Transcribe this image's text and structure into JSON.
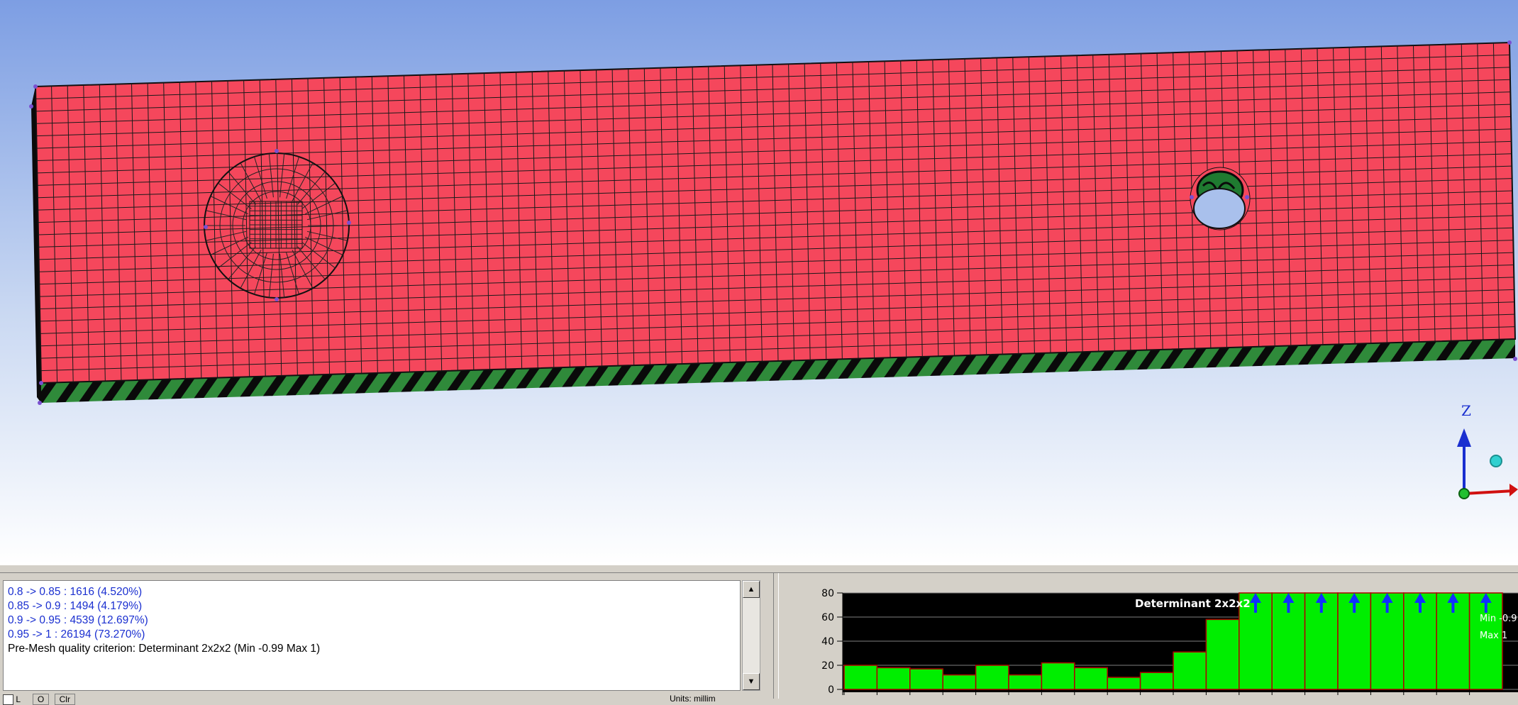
{
  "log": {
    "lines": [
      "0.8 -> 0.85 : 1616 (4.520%)",
      "0.85 -> 0.9 : 1494 (4.179%)",
      "0.9 -> 0.95 : 4539 (12.697%)",
      "0.95 -> 1 : 26194 (73.270%)",
      "Pre-Mesh quality criterion: Determinant 2x2x2 (Min -0.99 Max 1)"
    ],
    "footer_left_1": "L",
    "footer_left_2": "O",
    "footer_left_3": "Clr",
    "footer_units": "Units: millim"
  },
  "histogram": {
    "title": "Determinant 2x2x2",
    "min_label": "Min -0.9",
    "max_label": "Max 1"
  },
  "triad": {
    "z_label": "Z"
  },
  "chart_data": {
    "type": "bar",
    "title": "Determinant 2x2x2",
    "yticks": [
      "0",
      "20",
      "40",
      "60",
      "80"
    ],
    "ylim": [
      0,
      80
    ],
    "values": [
      20,
      18,
      17,
      12,
      20,
      12,
      22,
      18,
      10,
      14,
      31,
      58,
      80,
      80,
      80,
      80,
      80,
      80,
      80,
      80
    ],
    "overflow": [
      false,
      false,
      false,
      false,
      false,
      false,
      false,
      false,
      false,
      false,
      false,
      false,
      true,
      true,
      true,
      true,
      true,
      true,
      true,
      true
    ],
    "colors": {
      "bar": "#00ee00",
      "bar_edge": "#b00000",
      "background": "#000000",
      "overflow_arrow": "#1030ff"
    }
  },
  "colors": {
    "mesh_fill": "#f5475c",
    "mesh_line": "#1a1a1a",
    "hatch_green": "#2f8a3a"
  }
}
